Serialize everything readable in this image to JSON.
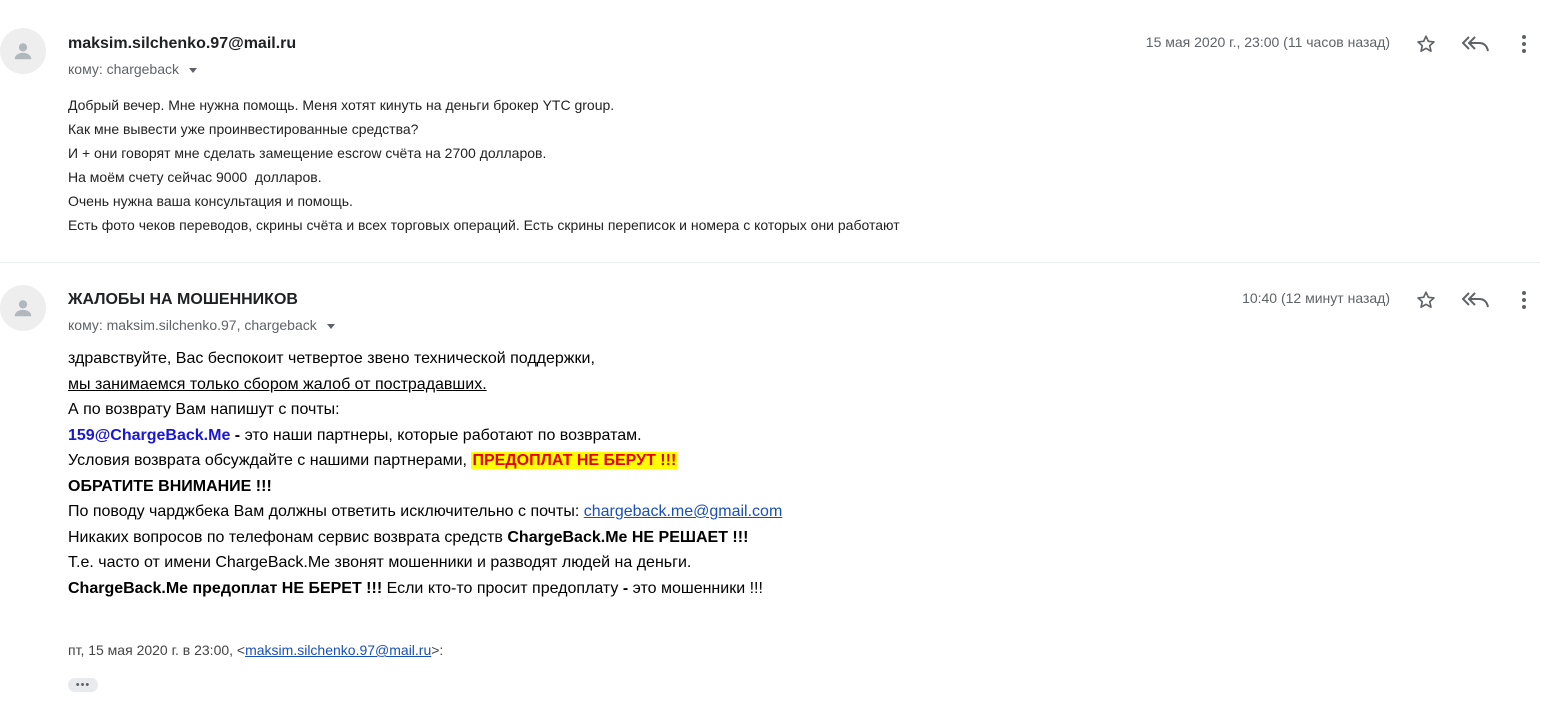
{
  "messages": [
    {
      "sender": "maksim.silchenko.97@mail.ru",
      "recipient": "кому: chargeback",
      "date": "15 мая 2020 г., 23:00 (11 часов назад)",
      "body_lines": [
        "Добрый вечер. Мне нужна помощь. Меня хотят кинуть на деньги брокер YTC group.",
        "Как мне вывести уже проинвестированные средства?",
        "И + они говорят мне сделать замещение escrow счёта на 2700 долларов.",
        "На моём счету сейчас 9000  долларов.",
        "Очень нужна ваша консультация и помощь.",
        "Есть фото чеков переводов, скрины счёта и всех торговых операций. Есть скрины переписок и номера с которых они работают"
      ],
      "icons": [
        "avatar-icon",
        "star-icon",
        "reply-icon",
        "more-vert-icon"
      ]
    },
    {
      "sender": "ЖАЛОБЫ НА МОШЕННИКОВ",
      "recipient": "кому: maksim.silchenko.97, chargeback",
      "date": "10:40 (12 минут назад)",
      "body": {
        "l1": "здравствуйте, Вас беспокоит четвертое звено технической поддержки,",
        "l2": "мы занимаемся только сбором жалоб от пострадавших.",
        "l3": "А по возврату Вам напишут с почты:",
        "l4_email": "159@ChargeBack.Me",
        "l4_dash": " - ",
        "l4_rest": "это наши партнеры, которые работают по возвратам.",
        "l5_text": "Условия возврата обсуждайте с нашими партнерами, ",
        "l5_highlight": "ПРЕДОПЛАТ НЕ БЕРУТ !!!",
        "l6": "ОБРАТИТЕ ВНИМАНИЕ !!!",
        "l7_text": "По поводу чарджбека Вам должны ответить исключительно с почты: ",
        "l7_link": "chargeback.me@gmail.com",
        "l8_text": "Никаких вопросов по телефонам сервис возврата средств ",
        "l8_bold": "ChargeBack.Me НЕ РЕШАЕТ !!!",
        "l9": "Т.е. часто от имени ChargeBack.Me звонят мошенники и разводят людей на деньги.",
        "l10_bold": "ChargeBack.Me предоплат НЕ БЕРЕТ !!!",
        "l10_text": " Если кто-то просит предоплату ",
        "l10_dash": "-",
        "l10_rest": " это мошенники !!!"
      },
      "quote": {
        "prefix": "пт, 15 мая 2020 г. в 23:00, <",
        "link": "maksim.silchenko.97@mail.ru",
        "suffix": ">:"
      },
      "show_trimmed_label": "•••",
      "icons": [
        "avatar-icon",
        "star-icon",
        "reply-icon",
        "more-vert-icon"
      ]
    }
  ],
  "colors": {
    "link": "#1a4fb8",
    "email_blue": "#1a17d4",
    "highlight_bg": "#ffff00",
    "highlight_fg": "#e60000",
    "meta_gray": "#5f6368"
  }
}
